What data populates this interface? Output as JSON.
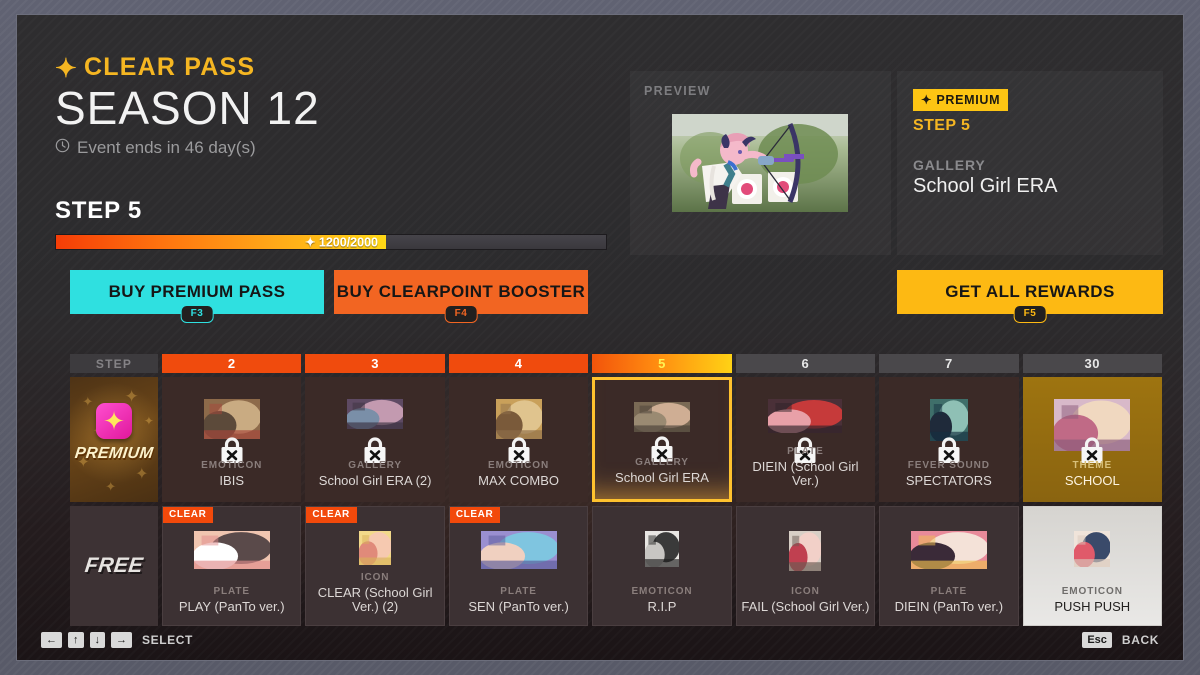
{
  "header": {
    "pass_label": "CLEAR PASS",
    "spark_icon": "spark-icon",
    "season": "SEASON 12",
    "clock_icon": "clock-icon",
    "event_ends": "Event ends in 46 day(s)",
    "step_title": "STEP 5"
  },
  "progress": {
    "label": "✦ 1200/2000",
    "current": 1200,
    "max": 2000,
    "percent": 60
  },
  "buttons": {
    "premium_pass": {
      "label": "BUY PREMIUM PASS",
      "key": "F3",
      "color": "#2fe0e0"
    },
    "clearpoint_booster": {
      "label": "BUY CLEARPOINT BOOSTER",
      "key": "F4",
      "color": "#f26522"
    },
    "get_all_rewards": {
      "label": "GET ALL REWARDS",
      "key": "F5",
      "color": "#fdb913"
    }
  },
  "preview": {
    "label": "PREVIEW",
    "image_name": "archery-girl-preview-image"
  },
  "info": {
    "badge": "✦ PREMIUM",
    "step": "STEP 5",
    "category": "GALLERY",
    "name": "School Girl ERA"
  },
  "grid": {
    "step_header_label": "STEP",
    "steps": [
      {
        "label": "2",
        "state": "done"
      },
      {
        "label": "3",
        "state": "done"
      },
      {
        "label": "4",
        "state": "done"
      },
      {
        "label": "5",
        "state": "current"
      },
      {
        "label": "6",
        "state": "locked"
      },
      {
        "label": "7",
        "state": "locked"
      },
      {
        "label": "30",
        "state": "locked"
      }
    ],
    "premium_row": {
      "label": "PREMIUM",
      "icon": "premium-star-icon",
      "cards": [
        {
          "category": "EMOTICON",
          "name": "IBIS",
          "locked": true,
          "selected": false,
          "style": "dark",
          "thumb": "ibis-thumb"
        },
        {
          "category": "GALLERY",
          "name": "School Girl ERA (2)",
          "locked": true,
          "selected": false,
          "style": "dark",
          "thumb": "school-girl-era-2-thumb"
        },
        {
          "category": "EMOTICON",
          "name": "MAX COMBO",
          "locked": true,
          "selected": false,
          "style": "dark",
          "thumb": "max-combo-thumb"
        },
        {
          "category": "GALLERY",
          "name": "School Girl ERA",
          "locked": true,
          "selected": true,
          "style": "dark",
          "thumb": "school-girl-era-thumb"
        },
        {
          "category": "PLATE",
          "name": "DIEIN (School Girl Ver.)",
          "locked": true,
          "selected": false,
          "style": "dark",
          "thumb": "diein-school-girl-thumb"
        },
        {
          "category": "FEVER SOUND",
          "name": "SPECTATORS",
          "locked": true,
          "selected": false,
          "style": "dark",
          "thumb": "spectators-thumb"
        },
        {
          "category": "THEME",
          "name": "SCHOOL",
          "locked": true,
          "selected": false,
          "style": "gold",
          "thumb": "school-theme-thumb"
        }
      ]
    },
    "free_row": {
      "label": "FREE",
      "cards": [
        {
          "category": "PLATE",
          "name": "PLAY (PanTo ver.)",
          "badge": "CLEAR",
          "style": "dark",
          "thumb": "play-panto-thumb"
        },
        {
          "category": "ICON",
          "name": "CLEAR (School Girl Ver.) (2)",
          "badge": "CLEAR",
          "style": "dark",
          "thumb": "clear-school-girl-thumb"
        },
        {
          "category": "PLATE",
          "name": "SEN (PanTo ver.)",
          "badge": "CLEAR",
          "style": "dark",
          "thumb": "sen-panto-thumb"
        },
        {
          "category": "EMOTICON",
          "name": "R.I.P",
          "badge": "",
          "style": "dark",
          "thumb": "rip-thumb"
        },
        {
          "category": "ICON",
          "name": "FAIL (School Girl Ver.)",
          "badge": "",
          "style": "dark",
          "thumb": "fail-school-girl-thumb"
        },
        {
          "category": "PLATE",
          "name": "DIEIN (PanTo ver.)",
          "badge": "",
          "style": "dark",
          "thumb": "diein-panto-thumb"
        },
        {
          "category": "EMOTICON",
          "name": "PUSH PUSH",
          "badge": "",
          "style": "light",
          "thumb": "push-push-thumb"
        }
      ]
    }
  },
  "bottombar": {
    "select_keys": [
      "←",
      "↑",
      "↓",
      "→"
    ],
    "select_label": "SELECT",
    "back_key": "Esc",
    "back_label": "BACK"
  },
  "colors": {
    "accent_gold": "#fdb913",
    "accent_orange": "#f2490b",
    "accent_cyan": "#2fe0e0",
    "panel_bg": "#2c2b2d"
  }
}
